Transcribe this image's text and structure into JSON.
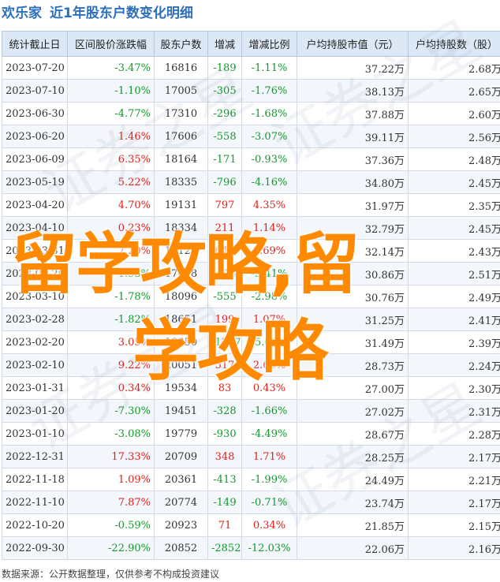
{
  "header": {
    "brand": "欢乐家",
    "title": "近1年股东户数变化明细"
  },
  "table": {
    "columns": [
      "统计截止日",
      "区间股价涨跌幅",
      "股东户数",
      "增减",
      "增减比例",
      "户均持股市值（元）",
      "户均持股数（股）"
    ],
    "rows": [
      {
        "date": "2023-07-20",
        "pct": "-3.47%",
        "pct_dir": "down",
        "holders": "16816",
        "chg": "-189",
        "chg_dir": "down",
        "ratio": "-1.11%",
        "ratio_dir": "down",
        "value": "37.22万",
        "shares": "2.68万"
      },
      {
        "date": "2023-07-10",
        "pct": "-1.10%",
        "pct_dir": "down",
        "holders": "17005",
        "chg": "-305",
        "chg_dir": "down",
        "ratio": "-1.76%",
        "ratio_dir": "down",
        "value": "38.13万",
        "shares": "2.65万"
      },
      {
        "date": "2023-06-30",
        "pct": "-4.77%",
        "pct_dir": "down",
        "holders": "17310",
        "chg": "-296",
        "chg_dir": "down",
        "ratio": "-1.68%",
        "ratio_dir": "down",
        "value": "37.88万",
        "shares": "2.60万"
      },
      {
        "date": "2023-06-20",
        "pct": "1.46%",
        "pct_dir": "up",
        "holders": "17606",
        "chg": "-558",
        "chg_dir": "down",
        "ratio": "-3.07%",
        "ratio_dir": "down",
        "value": "39.11万",
        "shares": "2.56万"
      },
      {
        "date": "2023-06-09",
        "pct": "6.35%",
        "pct_dir": "up",
        "holders": "18164",
        "chg": "-171",
        "chg_dir": "down",
        "ratio": "-0.93%",
        "ratio_dir": "down",
        "value": "37.36万",
        "shares": "2.48万"
      },
      {
        "date": "2023-05-19",
        "pct": "5.22%",
        "pct_dir": "up",
        "holders": "18335",
        "chg": "-796",
        "chg_dir": "down",
        "ratio": "-4.16%",
        "ratio_dir": "down",
        "value": "34.80万",
        "shares": "2.45万"
      },
      {
        "date": "2023-04-20",
        "pct": "4.70%",
        "pct_dir": "up",
        "holders": "19131",
        "chg": "797",
        "chg_dir": "up",
        "ratio": "4.35%",
        "ratio_dir": "up",
        "value": "31.97万",
        "shares": "2.35万"
      },
      {
        "date": "2023-04-10",
        "pct": "0.23%",
        "pct_dir": "up",
        "holders": "18334",
        "chg": "211",
        "chg_dir": "up",
        "ratio": "1.14%",
        "ratio_dir": "up",
        "value": "32.79万",
        "shares": "2.45万"
      },
      {
        "date": "2023-03-31",
        "pct": "7.20%",
        "pct_dir": "up",
        "holders": "18123",
        "chg": "645",
        "chg_dir": "up",
        "ratio": "3.69%",
        "ratio_dir": "up",
        "value": "32.14万",
        "shares": "2.43万"
      },
      {
        "date": "2023-03-20",
        "pct": "-1.93%",
        "pct_dir": "down",
        "holders": "17478",
        "chg": "-618",
        "chg_dir": "down",
        "ratio": "-3.41%",
        "ratio_dir": "down",
        "value": "30.86万",
        "shares": "2.51万"
      },
      {
        "date": "2023-03-10",
        "pct": "-1.78%",
        "pct_dir": "down",
        "holders": "18096",
        "chg": "-555",
        "chg_dir": "down",
        "ratio": "-2.98%",
        "ratio_dir": "down",
        "value": "30.76万",
        "shares": "2.49万"
      },
      {
        "date": "2023-02-28",
        "pct": "-1.82%",
        "pct_dir": "down",
        "holders": "18651",
        "chg": "199",
        "chg_dir": "up",
        "ratio": "1.07%",
        "ratio_dir": "up",
        "value": "31.25万",
        "shares": "2.41万"
      },
      {
        "date": "2023-02-20",
        "pct": "3.05%",
        "pct_dir": "up",
        "holders": "18850",
        "chg": "-1207",
        "chg_dir": "down",
        "ratio": "-5.69%",
        "ratio_dir": "down",
        "value": "31.49万",
        "shares": "2.39万"
      },
      {
        "date": "2023-02-10",
        "pct": "9.22%",
        "pct_dir": "up",
        "holders": "20051",
        "chg": "517",
        "chg_dir": "up",
        "ratio": "2.65%",
        "ratio_dir": "up",
        "value": "28.73万",
        "shares": "2.24万"
      },
      {
        "date": "2023-01-31",
        "pct": "0.34%",
        "pct_dir": "up",
        "holders": "19534",
        "chg": "83",
        "chg_dir": "up",
        "ratio": "0.43%",
        "ratio_dir": "up",
        "value": "27.00万",
        "shares": "2.30万"
      },
      {
        "date": "2023-01-20",
        "pct": "-7.30%",
        "pct_dir": "down",
        "holders": "19451",
        "chg": "-328",
        "chg_dir": "down",
        "ratio": "-1.66%",
        "ratio_dir": "down",
        "value": "27.02万",
        "shares": "2.31万"
      },
      {
        "date": "2023-01-10",
        "pct": "-3.08%",
        "pct_dir": "down",
        "holders": "19779",
        "chg": "-930",
        "chg_dir": "down",
        "ratio": "-4.49%",
        "ratio_dir": "down",
        "value": "28.67万",
        "shares": "2.28万"
      },
      {
        "date": "2022-12-31",
        "pct": "17.33%",
        "pct_dir": "up",
        "holders": "20709",
        "chg": "348",
        "chg_dir": "up",
        "ratio": "1.71%",
        "ratio_dir": "up",
        "value": "28.25万",
        "shares": "2.17万"
      },
      {
        "date": "2022-11-18",
        "pct": "1.09%",
        "pct_dir": "up",
        "holders": "20361",
        "chg": "-413",
        "chg_dir": "down",
        "ratio": "-1.99%",
        "ratio_dir": "down",
        "value": "24.49万",
        "shares": "2.21万"
      },
      {
        "date": "2022-11-10",
        "pct": "7.87%",
        "pct_dir": "up",
        "holders": "20774",
        "chg": "-149",
        "chg_dir": "down",
        "ratio": "-0.71%",
        "ratio_dir": "down",
        "value": "23.74万",
        "shares": "2.17万"
      },
      {
        "date": "2022-10-20",
        "pct": "-0.59%",
        "pct_dir": "down",
        "holders": "20923",
        "chg": "71",
        "chg_dir": "up",
        "ratio": "0.34%",
        "ratio_dir": "up",
        "value": "21.85万",
        "shares": "2.15万"
      },
      {
        "date": "2022-09-30",
        "pct": "-22.90%",
        "pct_dir": "down",
        "holders": "20852",
        "chg": "-2852",
        "chg_dir": "down",
        "ratio": "-12.03%",
        "ratio_dir": "down",
        "value": "22.06万",
        "shares": "2.16万"
      }
    ]
  },
  "footer": {
    "source": "数据来源：公开数据整理，仅供参考不构成投资建议"
  },
  "overlay": {
    "line1": "留学攻略,留",
    "line2": "学攻略"
  },
  "watermark": {
    "text": "证券之星"
  },
  "colors": {
    "header_blue": "#2c6fbd",
    "up_red": "#e0201a",
    "down_green": "#119a2a",
    "overlay_orange": "#ff8a00",
    "table_header_bg": "#dde8f7"
  }
}
